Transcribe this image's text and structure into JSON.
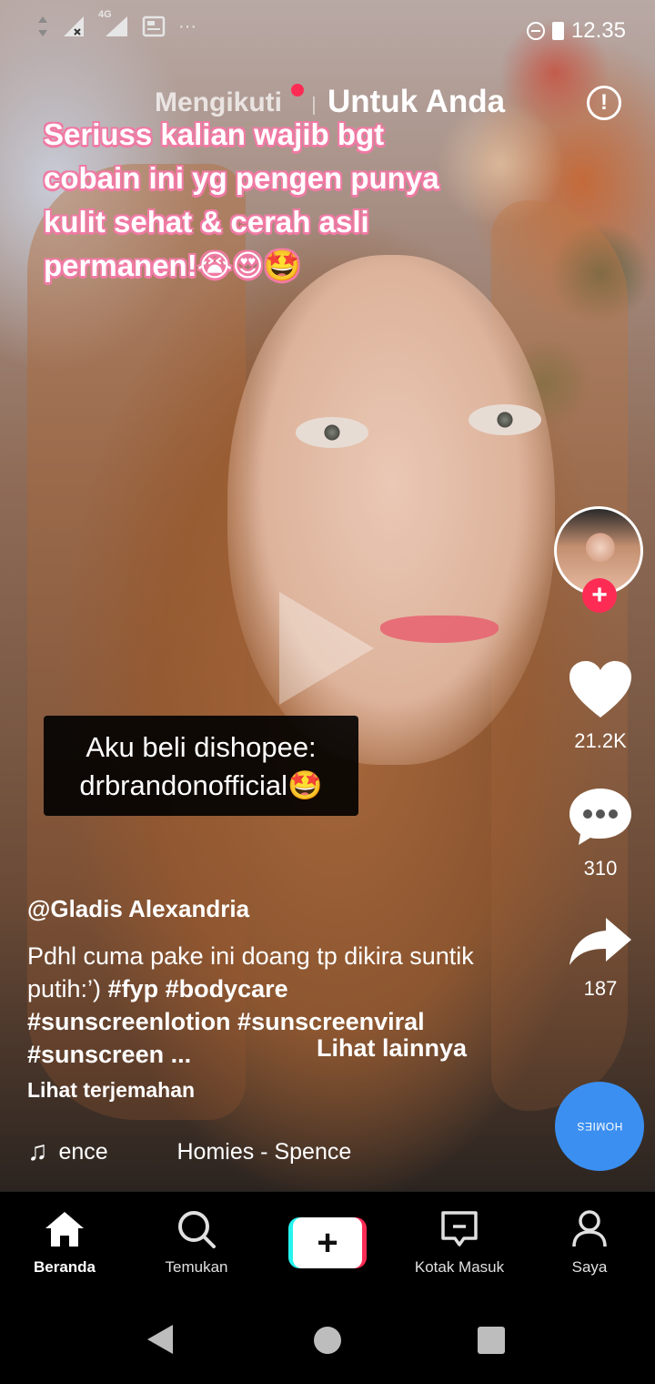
{
  "status_bar": {
    "left_icons": [
      "updown-arrows-icon",
      "signal-x-icon",
      "4g-signal-icon",
      "news-icon",
      "more-dots-icon"
    ],
    "network_label": "4G",
    "more": "···",
    "time": "12.35"
  },
  "top_tabs": {
    "following": "Mengikuti",
    "for_you": "Untuk Anda"
  },
  "video": {
    "overlay_text": "Seriuss kalian wajib bgt\ncobain ini yg pengen punya\nkulit sehat & cerah asli\npermanen!😭😍🤩",
    "caption_line1": "Aku beli dishopee:",
    "caption_line2": "drbrandonofficial🤩"
  },
  "actions": {
    "likes": "21.2K",
    "comments": "310",
    "shares": "187"
  },
  "post": {
    "author": "@Gladis Alexandria",
    "description_text": "Pdhl cuma pake ini doang tp dikira suntik putih:’) ",
    "tags_line1": "#fyp #bodycare",
    "tags_line2": "#sunscreenlotion #sunscreenviral",
    "tags_line3": "#sunscreen",
    "ellipsis": " ...",
    "see_more": "Lihat lainnya",
    "translate": "Lihat terjemahan"
  },
  "music": {
    "scroll_a": "ence",
    "scroll_b": "Homies - Spence",
    "disc_label": "HOMIES"
  },
  "bottom_nav": {
    "home": "Beranda",
    "discover": "Temukan",
    "inbox": "Kotak Masuk",
    "profile": "Saya"
  },
  "colors": {
    "accent_red": "#fe2c55",
    "accent_cyan": "#25f4ee",
    "overlay_pink": "#f07aa4",
    "disc_blue": "#3b8ff0"
  }
}
